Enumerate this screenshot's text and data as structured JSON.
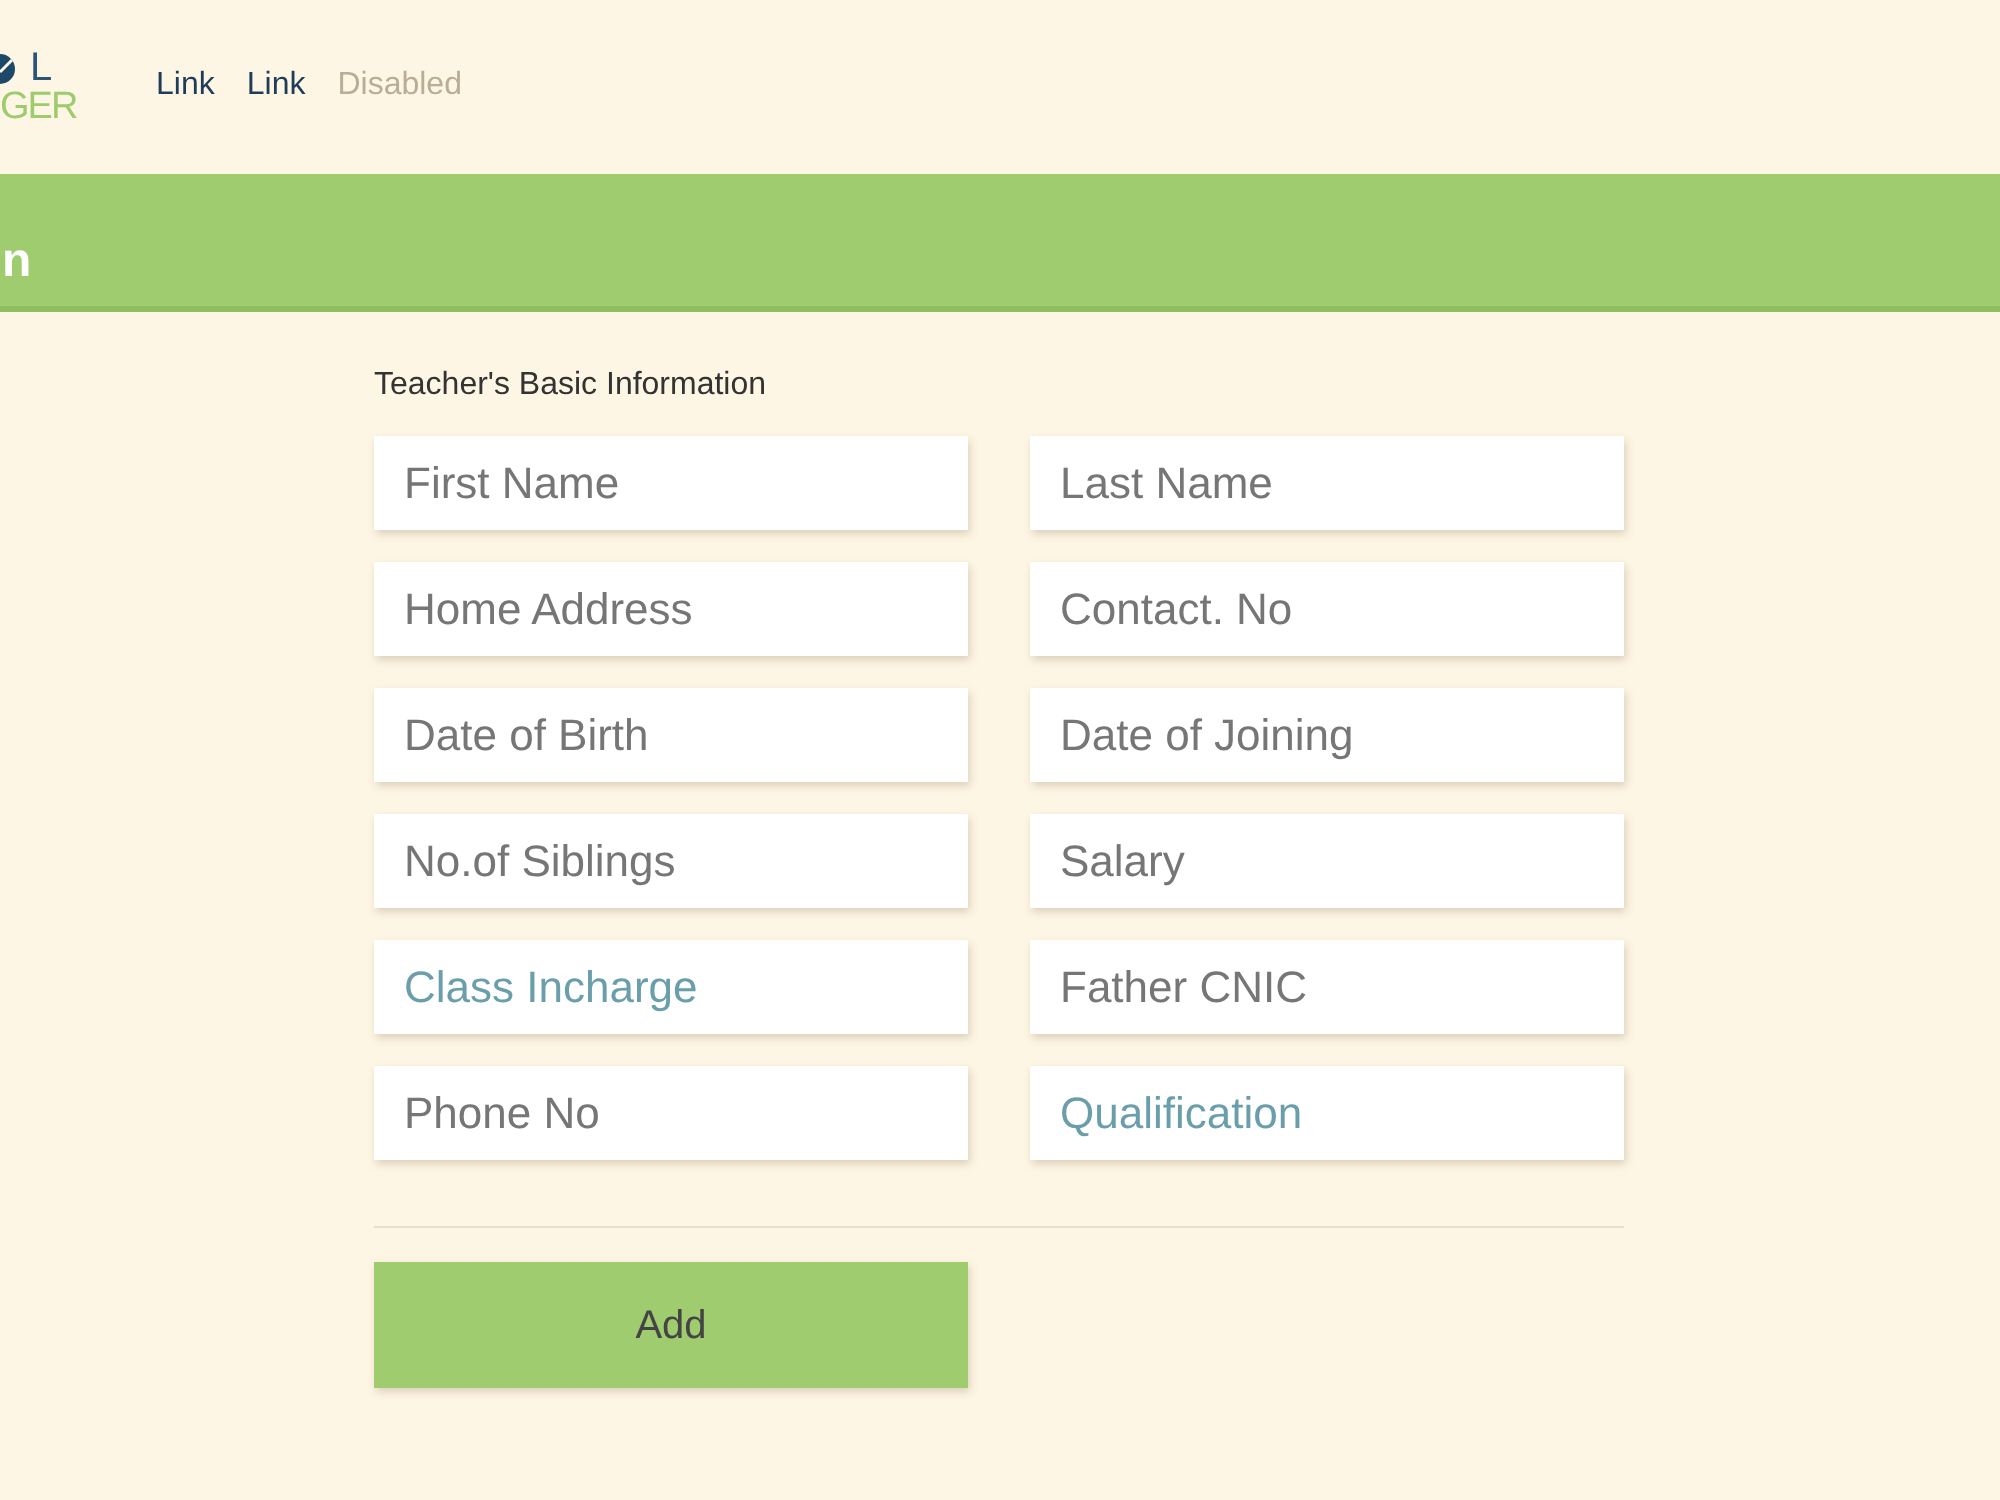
{
  "logo": {
    "line_1": "L",
    "line_2": "GER"
  },
  "nav": {
    "links": [
      {
        "label": "Link",
        "disabled": false
      },
      {
        "label": "Link",
        "disabled": false
      },
      {
        "label": "Disabled",
        "disabled": true
      }
    ]
  },
  "header": {
    "title": "n"
  },
  "form": {
    "section_title": "Teacher's Basic Information",
    "fields": [
      {
        "kind": "text",
        "placeholder": "First Name"
      },
      {
        "kind": "text",
        "placeholder": "Last Name"
      },
      {
        "kind": "text",
        "placeholder": "Home Address"
      },
      {
        "kind": "text",
        "placeholder": "Contact. No"
      },
      {
        "kind": "text",
        "placeholder": "Date of Birth"
      },
      {
        "kind": "text",
        "placeholder": "Date of Joining"
      },
      {
        "kind": "text",
        "placeholder": "No.of Siblings"
      },
      {
        "kind": "text",
        "placeholder": "Salary"
      },
      {
        "kind": "select",
        "placeholder": "Class Incharge"
      },
      {
        "kind": "text",
        "placeholder": "Father CNIC"
      },
      {
        "kind": "text",
        "placeholder": "Phone No"
      },
      {
        "kind": "select",
        "placeholder": "Qualification"
      }
    ],
    "submit": {
      "label": "Add"
    }
  }
}
